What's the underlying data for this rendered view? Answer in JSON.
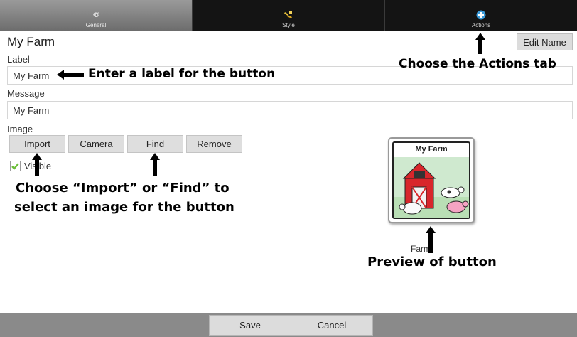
{
  "tabs": [
    {
      "label": "General",
      "icon": "gear-icon",
      "active": true
    },
    {
      "label": "Style",
      "icon": "paint-brush-icon",
      "active": false
    },
    {
      "label": "Actions",
      "icon": "plus-circle-icon",
      "active": false
    }
  ],
  "header": {
    "title": "My Farm",
    "edit_name_label": "Edit Name"
  },
  "form": {
    "label_caption": "Label",
    "label_value": "My Farm",
    "message_caption": "Message",
    "message_value": "My Farm",
    "image_caption": "Image",
    "image_buttons": [
      "Import",
      "Camera",
      "Find",
      "Remove"
    ],
    "visible_label": "Visible",
    "visible_checked": true
  },
  "preview": {
    "button_title": "My Farm",
    "caption": "Farm"
  },
  "annotations": {
    "label_hint": "Enter a label for the button",
    "actions_hint": "Choose the Actions tab",
    "image_hint_line1": "Choose “Import” or “Find” to",
    "image_hint_line2": "select an image for the button",
    "preview_hint": "Preview of button"
  },
  "bottom": {
    "save_label": "Save",
    "cancel_label": "Cancel"
  },
  "colors": {
    "tabbar": "#141414",
    "active_tab": "#8a8a8a",
    "actions_icon": "#3a9ad9",
    "checkmark": "#6cbf3a",
    "barn_red": "#d8262b"
  }
}
